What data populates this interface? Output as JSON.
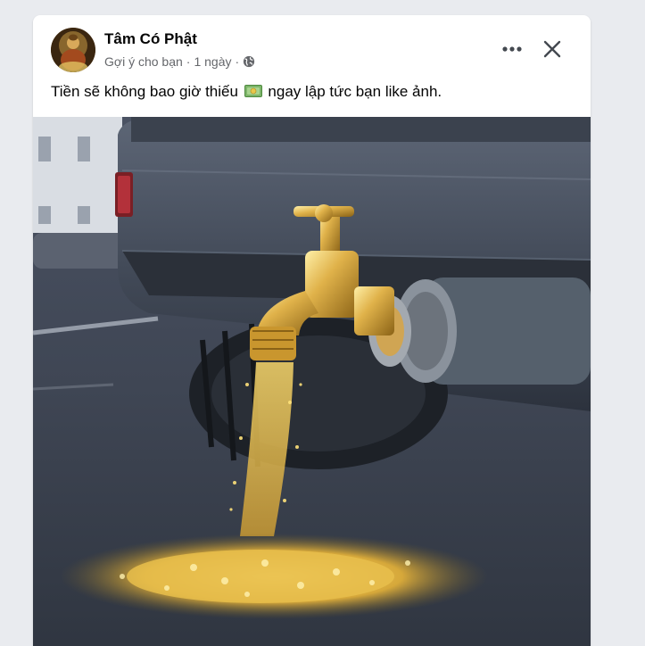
{
  "post": {
    "author": "Tâm Có Phật",
    "suggestion_label": "Gợi ý cho bạn",
    "separator": "·",
    "timestamp": "1 ngày",
    "audience_icon": "globe-icon",
    "text_before": "Tiền sẽ không bao giờ thiếu",
    "text_emoji": "money-with-wings-emoji",
    "text_after": "ngay lập tức bạn like ảnh."
  },
  "actions": {
    "more_icon": "more-options-icon",
    "close_icon": "close-icon"
  },
  "colors": {
    "background": "#e9ebef",
    "card": "#ffffff",
    "primary_text": "#050505",
    "secondary_text": "#65676b"
  }
}
